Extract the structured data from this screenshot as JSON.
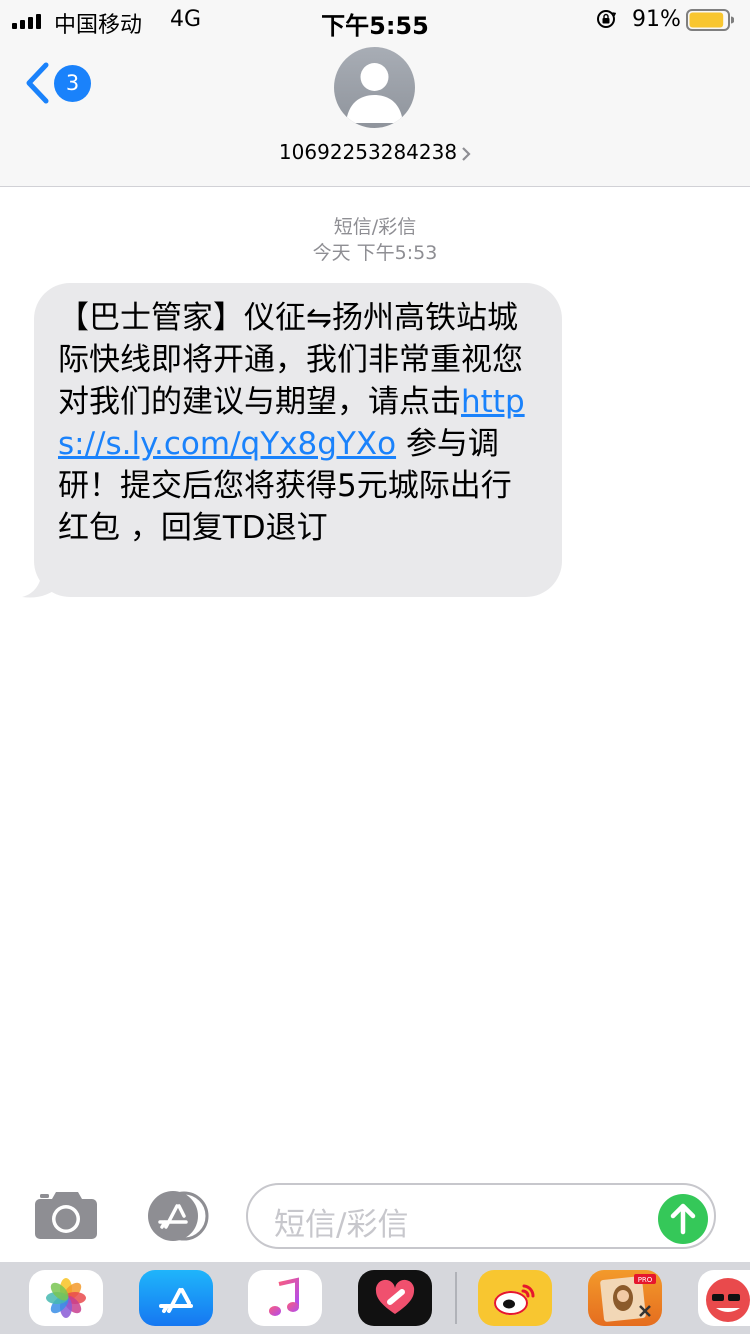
{
  "status_bar": {
    "carrier": "中国移动",
    "network": "4G",
    "time": "下午5:55",
    "battery_percent": "91%",
    "battery_level": 0.91,
    "icons": [
      "signal-icon",
      "orientation-lock-icon",
      "battery-icon"
    ]
  },
  "header": {
    "back_badge": "3",
    "contact_number": "10692253284238",
    "icons": [
      "back-chevron-icon",
      "avatar-icon",
      "chevron-right-icon"
    ]
  },
  "thread": {
    "message_type": "短信/彩信",
    "timestamp": "今天 下午5:53",
    "message": {
      "text_before_link": "【巴士管家】仪征⇋扬州高铁站城际快线即将开通，我们非常重视您对我们的建议与期望，请点击",
      "link": "https://s.ly.com/qYx8gYXo",
      "text_after_link": " 参与调研！提交后您将获得5元城际出行红包 ，回复TD退订"
    }
  },
  "input_bar": {
    "placeholder": "短信/彩信",
    "icons": [
      "camera-icon",
      "app-store-icon",
      "send-arrow-icon"
    ]
  },
  "app_drawer": {
    "apps": [
      "photos-icon",
      "app-store-icon",
      "music-icon",
      "heart-app-icon",
      "weibo-icon",
      "photo-editor-pro-icon",
      "partial-app-icon"
    ]
  },
  "colors": {
    "accent": "#1a82fb",
    "bubble": "#e9e9eb",
    "send": "#35c859",
    "battery": "#f8c630"
  }
}
